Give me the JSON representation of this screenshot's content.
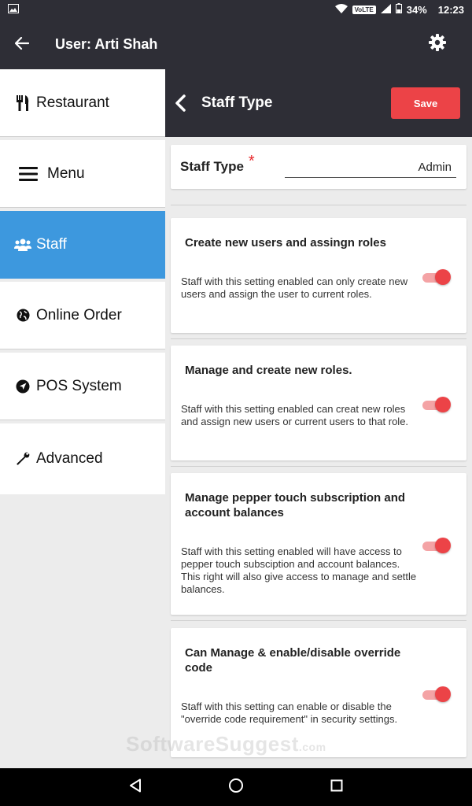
{
  "status_bar": {
    "volte": "VoLTE",
    "battery": "34%",
    "time": "12:23"
  },
  "app_bar": {
    "title": "User: Arti Shah"
  },
  "sidebar": {
    "items": [
      {
        "label": "Restaurant",
        "icon": "utensils-icon"
      },
      {
        "label": "Menu",
        "icon": "hamburger-menu-icon"
      },
      {
        "label": "Staff",
        "icon": "users-icon",
        "active": true
      },
      {
        "label": "Online Order",
        "icon": "globe-icon"
      },
      {
        "label": "POS System",
        "icon": "location-arrow-icon"
      },
      {
        "label": "Advanced",
        "icon": "wrench-icon"
      }
    ]
  },
  "main": {
    "header_title": "Staff Type",
    "save_label": "Save",
    "staff_type": {
      "label": "Staff Type",
      "required_mark": "*",
      "value": "Admin"
    },
    "permissions": [
      {
        "title": "Create new users and assingn roles",
        "description": "Staff with this setting enabled can only create new users and assign the user to current roles.",
        "enabled": true
      },
      {
        "title": "Manage and create new roles.",
        "description": "Staff with this setting enabled can creat new roles and assign new users or current users to that role.",
        "enabled": true
      },
      {
        "title": "Manage pepper touch subscription and account balances",
        "description": "Staff with this setting enabled will have access to pepper touch subsciption and account balances.  This right will also give access to manage and settle balances.",
        "enabled": true
      },
      {
        "title": "Can Manage & enable/disable override code",
        "description": "Staff with this setting can enable or disable the \"override code requirement\" in security settings.",
        "enabled": true
      }
    ]
  },
  "watermark": {
    "text": "SoftwareSuggest",
    "suffix": ".com"
  },
  "colors": {
    "header": "#2e2e36",
    "active": "#3d98de",
    "accent": "#ec4347"
  }
}
